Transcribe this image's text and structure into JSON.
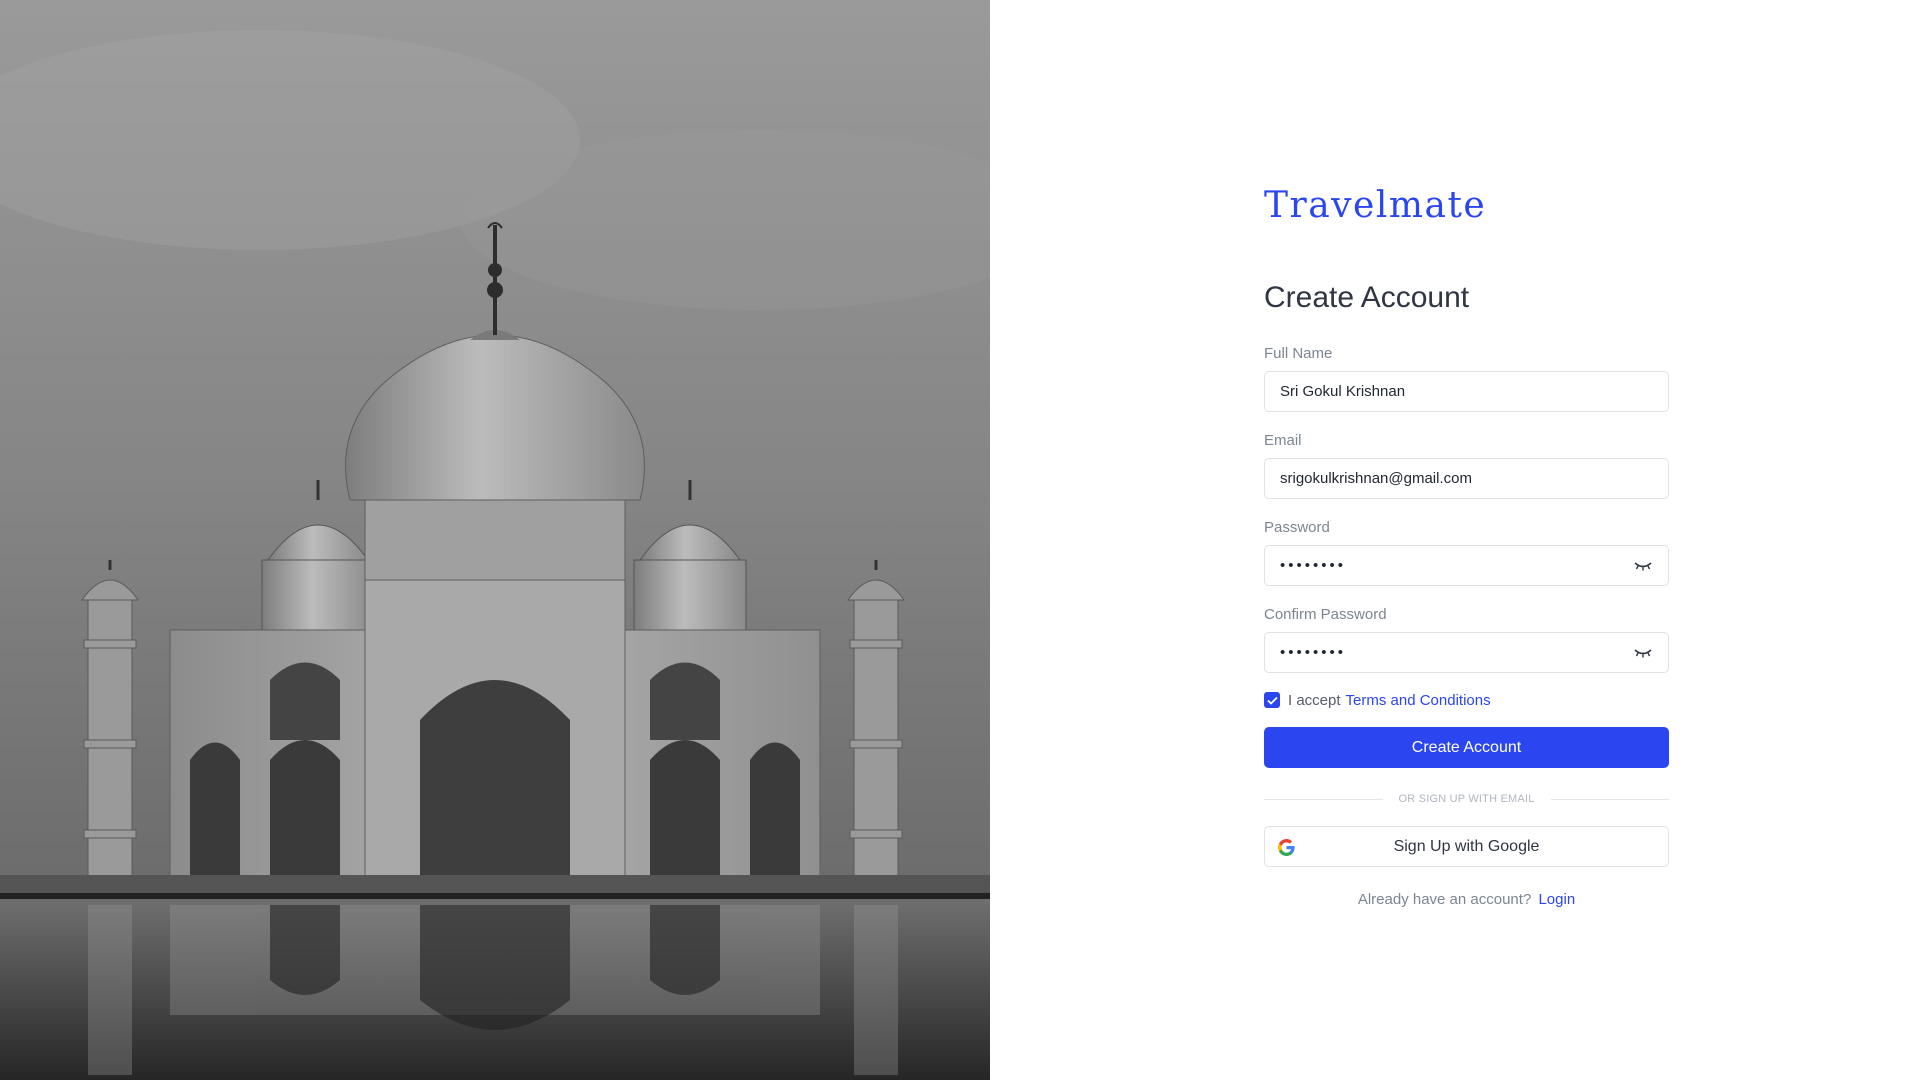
{
  "hero": {
    "image": "taj-mahal-black-and-white"
  },
  "brand": {
    "name": "Travelmate",
    "color": "#2b46f0"
  },
  "form": {
    "title": "Create Account",
    "fields": [
      {
        "label": "Full Name",
        "value": "Sri Gokul Krishnan",
        "type": "text"
      },
      {
        "label": "Email",
        "value": "srigokulkrishnan@gmail.com",
        "type": "email"
      },
      {
        "label": "Password",
        "value": "••••••••",
        "type": "password",
        "icon": "eye-closed-icon"
      },
      {
        "label": "Confirm Password",
        "value": "••••••••",
        "type": "password",
        "icon": "eye-closed-icon"
      }
    ],
    "terms": {
      "prefix": "I accept",
      "link": "Terms and Conditions",
      "checked": true
    },
    "submit_label": "Create Account",
    "divider_text": "OR SIGN UP WITH EMAIL",
    "google_label": "Sign Up with Google",
    "google_icon": "google-icon",
    "footer": {
      "text": "Already have an account?",
      "link": "Login"
    }
  },
  "colors": {
    "accent": "#2b46f0",
    "border": "#dfe2e7",
    "label": "#7d8591"
  }
}
